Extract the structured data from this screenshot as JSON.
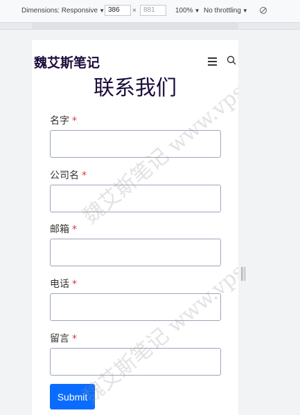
{
  "devtools": {
    "dimensions_label": "Dimensions: Responsive",
    "width": "386",
    "height_placeholder": "881",
    "times": "×",
    "zoom": "100%",
    "throttling": "No throttling"
  },
  "site": {
    "title": "魏艾斯笔记"
  },
  "page": {
    "heading": "联系我们"
  },
  "form": {
    "fields": [
      {
        "label": "名字",
        "required": "*"
      },
      {
        "label": "公司名",
        "required": "*"
      },
      {
        "label": "邮箱",
        "required": "*"
      },
      {
        "label": "电话",
        "required": "*"
      },
      {
        "label": "留言",
        "required": "*"
      }
    ],
    "submit": "Submit"
  },
  "watermark": {
    "text": "魏艾斯笔记 www.vpssss.net"
  }
}
